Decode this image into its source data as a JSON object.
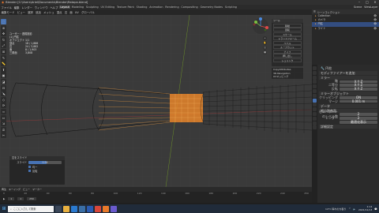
{
  "window": {
    "title": "Blender [C:\\Users\\Ariel\\Documents\\Blender\\Ratapa.blend]"
  },
  "menu": [
    "ファイル",
    "編集",
    "レンダー",
    "ウィンドウ",
    "ヘルプ"
  ],
  "workspace_tabs": [
    "Layout",
    "Modeling",
    "Sculpting",
    "UV Editing",
    "Texture Paint",
    "Shading",
    "Animation",
    "Rendering",
    "Compositing",
    "Geometry Nodes",
    "Scripting"
  ],
  "active_tab": "Layout",
  "scene": {
    "name": "Scene",
    "view_layer": "ViewLayer"
  },
  "viewport_header": [
    "編集モード",
    "ビュー",
    "選択",
    "追加",
    "メッシュ",
    "頂点",
    "辺",
    "面",
    "UV",
    "グローバル"
  ],
  "stats": {
    "title": "ユーザー・透視投影",
    "object": "(1) 円柱",
    "rows": [
      {
        "k": "オブジェクト",
        "v": "1/1"
      },
      {
        "k": "頂点",
        "v": "16 / 1,886"
      },
      {
        "k": "辺",
        "v": "24 / 3,882"
      },
      {
        "k": "面",
        "v": "8 / 1,903"
      },
      {
        "k": "三角面",
        "v": "3,808"
      }
    ]
  },
  "n_panel": {
    "header": "ツール",
    "items": [
      "移動",
      "回転",
      "スケール",
      "トランスフォーム",
      "ベベル",
      "ループカット",
      "ナイフ",
      "押し出し",
      "シュリンク"
    ]
  },
  "n_panel2": [
    "CopyAttributes",
    "3D-Navigation",
    "UVマッピング"
  ],
  "last_operator": {
    "title": "辺をスライド",
    "rows": [
      {
        "lbl": "スライド",
        "val": "0.54",
        "fraction": 0.54
      }
    ],
    "checks": [
      "均一",
      "反転"
    ]
  },
  "timeline": {
    "menu": [
      "再生",
      "キーイング",
      "ビュー",
      "マーカー"
    ],
    "ticks": [
      "0",
      "20",
      "40",
      "60",
      "80",
      "100",
      "120",
      "140",
      "160",
      "180",
      "200",
      "220",
      "240",
      "250"
    ],
    "frame": "1",
    "start": "1",
    "end": "250"
  },
  "outliner": {
    "header": "シーンコレクション",
    "items": [
      {
        "name": "Collection",
        "sel": false
      },
      {
        "name": "カメラ",
        "sel": false
      },
      {
        "name": "円柱",
        "sel": true
      },
      {
        "name": "ライト",
        "sel": false
      }
    ]
  },
  "properties": {
    "object_name": "円柱",
    "sections": [
      {
        "title": "モディファイアーを追加",
        "rows": []
      },
      {
        "title": "ミラー",
        "rows": [
          {
            "l": "軸",
            "v": "X  Y  Z"
          },
          {
            "l": "二等分",
            "v": "X  Y  Z"
          },
          {
            "l": "反転",
            "v": "X  Y  Z"
          }
        ]
      },
      {
        "title": "ミラーオブジェクト",
        "rows": [
          {
            "l": "クリッピング",
            "v": "ON"
          },
          {
            "l": "マージ",
            "v": "0.001 m"
          }
        ]
      },
      {
        "title": "データ",
        "rows": []
      },
      {
        "title": "細分割曲面",
        "rows": [
          {
            "l": "ビューポートのレベル数",
            "v": "2"
          },
          {
            "l": "レンダー",
            "v": "2"
          },
          {
            "l": "",
            "v": "最適化表示"
          }
        ]
      },
      {
        "title": "詳細設定",
        "rows": []
      }
    ]
  },
  "taskbar": {
    "search_placeholder": "ここに入力して検索",
    "weather": "14°C 晴れのち曇り",
    "time": "1:14",
    "date": "2021/11/13"
  },
  "colors": {
    "accent": "#4772b3",
    "selection": "#f5a040",
    "viewport_bg": "#3a3a3a"
  }
}
